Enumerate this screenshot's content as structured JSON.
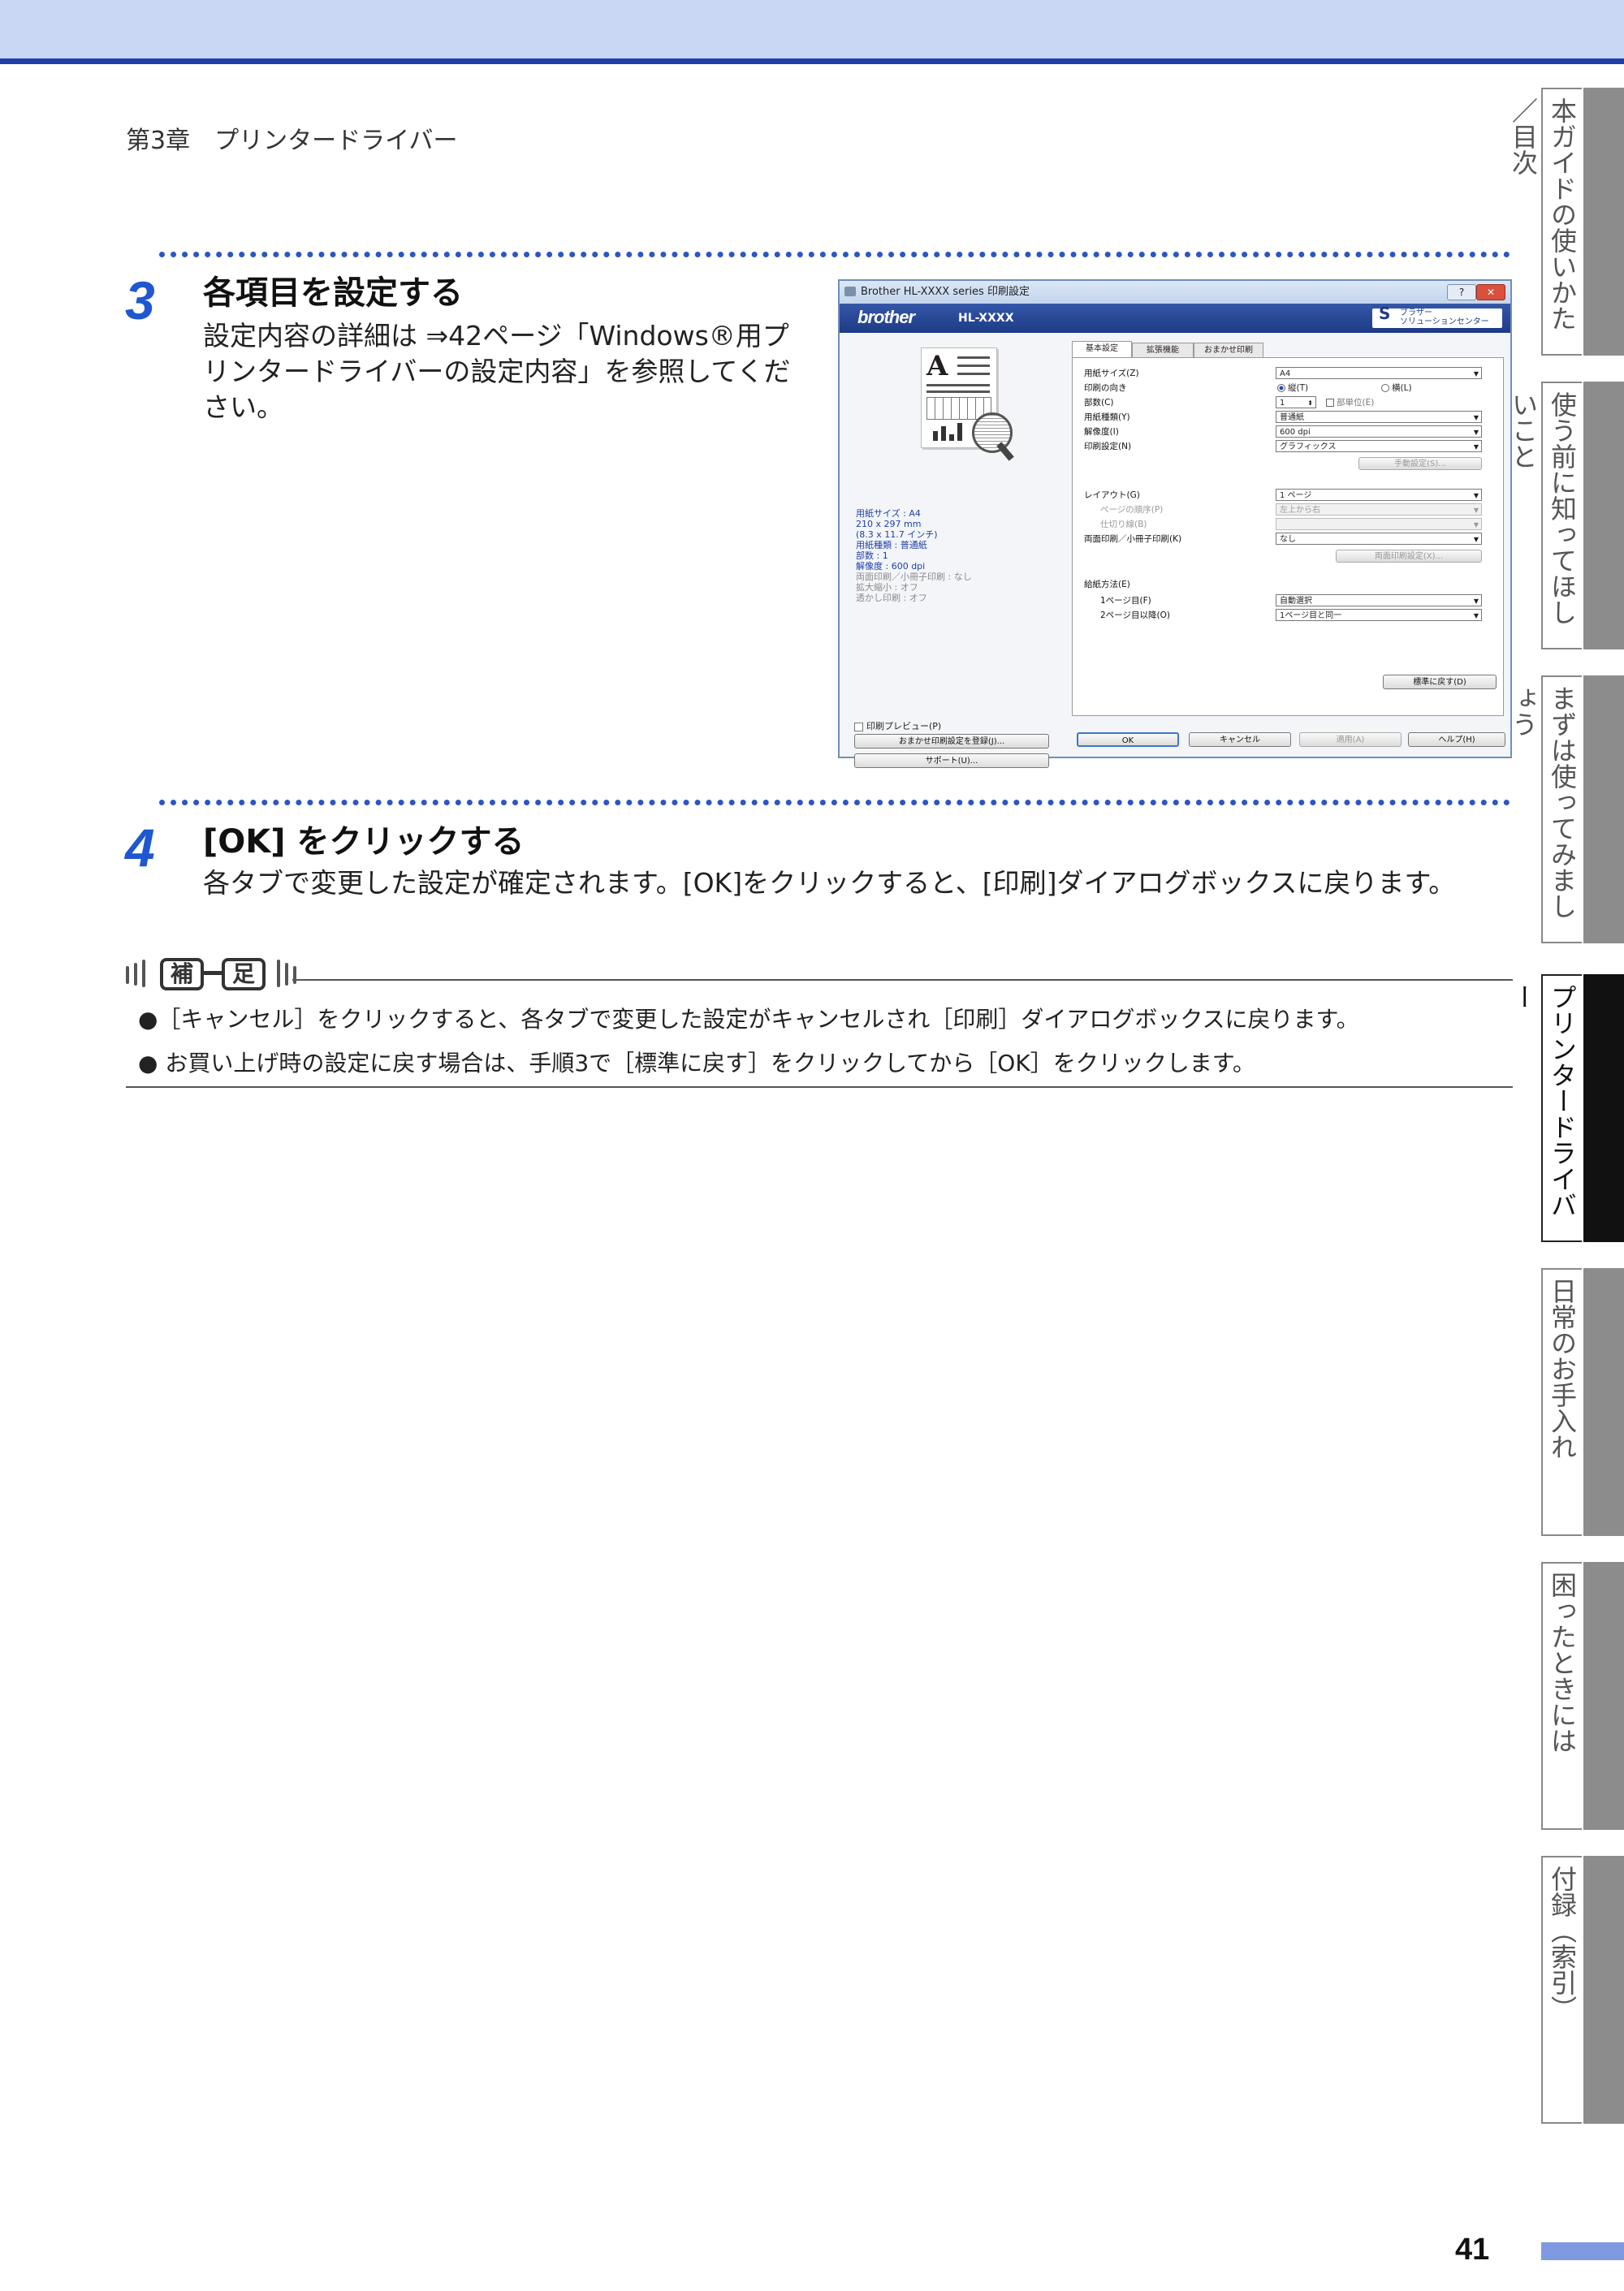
{
  "header": {
    "chapter": "第3章　プリンタードライバー"
  },
  "step3": {
    "number": "3",
    "title": "各項目を設定する",
    "body_lines": [
      "設定内容の詳細は ⇒42ページ「Windows®用プ",
      "リンタードライバーの設定内容」を参照してくだ",
      "さい。"
    ]
  },
  "dialog": {
    "title": "Brother HL-XXXX series 印刷設定",
    "brand": "brother",
    "model": "HL-XXXX",
    "solutions_lines": [
      "ブラザー",
      "ソリューションセンター"
    ],
    "tabs": [
      "基本設定",
      "拡張機能",
      "おまかせ印刷"
    ],
    "info_lines": [
      "用紙サイズ : A4",
      "210 x 297 mm",
      "(8.3 x 11.7 インチ)",
      "用紙種類 : 普通紙",
      "部数 : 1",
      "解像度 : 600 dpi",
      "両面印刷／小冊子印刷 : なし",
      "拡大縮小 : オフ",
      "透かし印刷 : オフ"
    ],
    "preview_checkbox": "印刷プレビュー(P)",
    "left_buttons": [
      "おまかせ印刷設定を登録(J)...",
      "サポート(U)..."
    ],
    "rows": {
      "paper_size": {
        "label": "用紙サイズ(Z)",
        "value": "A4"
      },
      "orientation": {
        "label": "印刷の向き",
        "option1": "縦(T)",
        "option2": "横(L)"
      },
      "copies": {
        "label": "部数(C)",
        "value": "1",
        "collate": "部単位(E)"
      },
      "media_type": {
        "label": "用紙種類(Y)",
        "value": "普通紙"
      },
      "resolution": {
        "label": "解像度(I)",
        "value": "600 dpi"
      },
      "print_setting": {
        "label": "印刷設定(N)",
        "value": "グラフィックス",
        "button": "手動設定(S)..."
      },
      "layout": {
        "label": "レイアウト(G)",
        "value": "1 ページ"
      },
      "page_order": {
        "label": "ページの順序(P)",
        "value": "左上から右"
      },
      "border": {
        "label": "仕切り線(B)",
        "value": ""
      },
      "duplex": {
        "label": "両面印刷／小冊子印刷(K)",
        "value": "なし",
        "button": "両面印刷設定(X)..."
      },
      "paper_source": {
        "label": "給紙方法(E)"
      },
      "first_page": {
        "label": "1ページ目(F)",
        "value": "自動選択"
      },
      "other_pages": {
        "label": "2ページ目以降(O)",
        "value": "1ページ目と同一"
      }
    },
    "default_button": "標準に戻す(D)",
    "bottom_buttons": [
      "OK",
      "キャンセル",
      "適用(A)",
      "ヘルプ(H)"
    ]
  },
  "step4": {
    "number": "4",
    "title": "[OK] をクリックする",
    "body": "各タブで変更した設定が確定されます。[OK]をクリックすると、[印刷]ダイアログボックスに戻ります。"
  },
  "note": {
    "label_chars": [
      "補",
      "足"
    ],
    "bullets": [
      "●［キャンセル］をクリックすると、各タブで変更した設定がキャンセルされ［印刷］ダイアログボックスに戻ります。",
      "● お買い上げ時の設定に戻す場合は、手順3で［標準に戻す］をクリックしてから［OK］をクリックします。"
    ]
  },
  "side_tabs": [
    "本ガイドの使いかた／目次",
    "使う前に知ってほしいこと",
    "まずは使ってみましょう",
    "プリンタードライバー",
    "日常のお手入れ",
    "困ったときには",
    "付録（索引）"
  ],
  "page_number": "41"
}
